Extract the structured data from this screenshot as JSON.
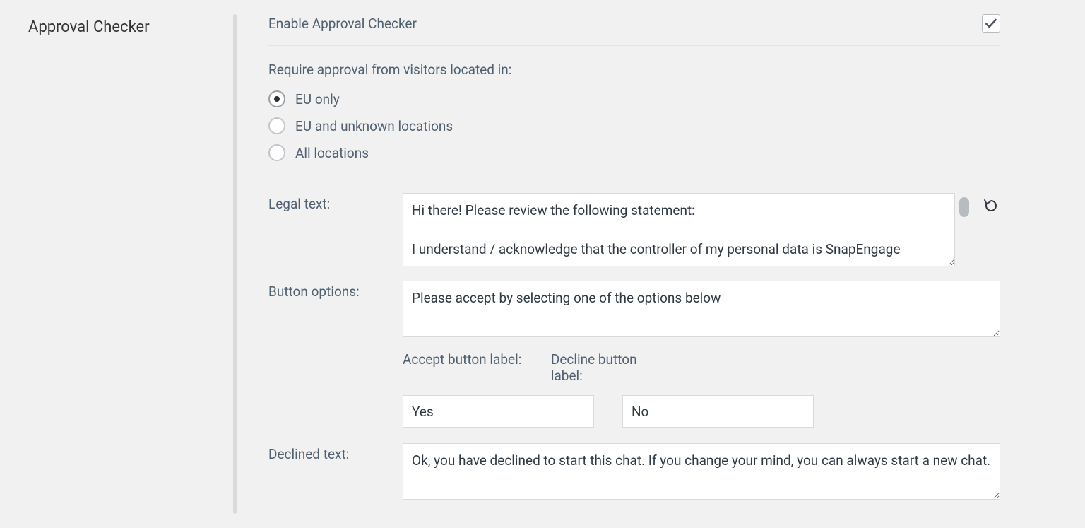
{
  "section": {
    "title": "Approval Checker"
  },
  "enable": {
    "label": "Enable Approval Checker",
    "checked": true
  },
  "locations": {
    "hint": "Require approval from visitors located in:",
    "options": [
      {
        "id": "eu",
        "label": "EU only",
        "checked": true
      },
      {
        "id": "eu_unk",
        "label": "EU and unknown locations",
        "checked": false
      },
      {
        "id": "all",
        "label": "All locations",
        "checked": false
      }
    ]
  },
  "legal": {
    "label": "Legal text:",
    "value": "Hi there! Please review the following statement:\n\nI understand / acknowledge that the controller of my personal data is SnapEngage"
  },
  "button_options": {
    "label": "Button options:",
    "value": "Please accept by selecting one of the options below"
  },
  "accept": {
    "label": "Accept button label:",
    "value": "Yes"
  },
  "decline": {
    "label": "Decline button label:",
    "value": "No"
  },
  "declined_text": {
    "label": "Declined text:",
    "value": "Ok, you have declined to start this chat. If you change your mind, you can always start a new chat."
  },
  "icons": {
    "undo": "undo-icon",
    "check": "check-icon"
  }
}
